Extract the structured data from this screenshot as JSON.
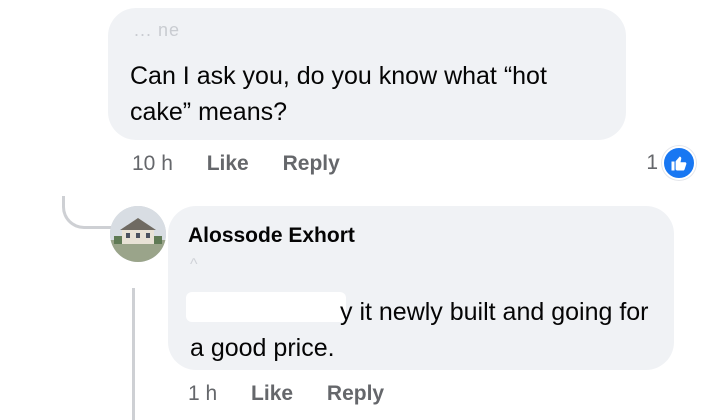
{
  "comment1": {
    "partial_name": "... ne",
    "text": "Can I ask you, do you know what “hot cake” means?",
    "time": "10 h",
    "like_label": "Like",
    "reply_label": "Reply",
    "reaction_count": "1",
    "reaction_icon": "thumbs-up-icon"
  },
  "comment2": {
    "author": "Alossode Exhort",
    "text_visible": "y it newly built and going for a good price.",
    "time": "1 h",
    "like_label": "Like",
    "reply_label": "Reply"
  },
  "colors": {
    "bubble_bg": "#f0f2f5",
    "meta_text": "#65676b",
    "like_blue": "#1877f2",
    "thread_line": "#ced0d4"
  }
}
